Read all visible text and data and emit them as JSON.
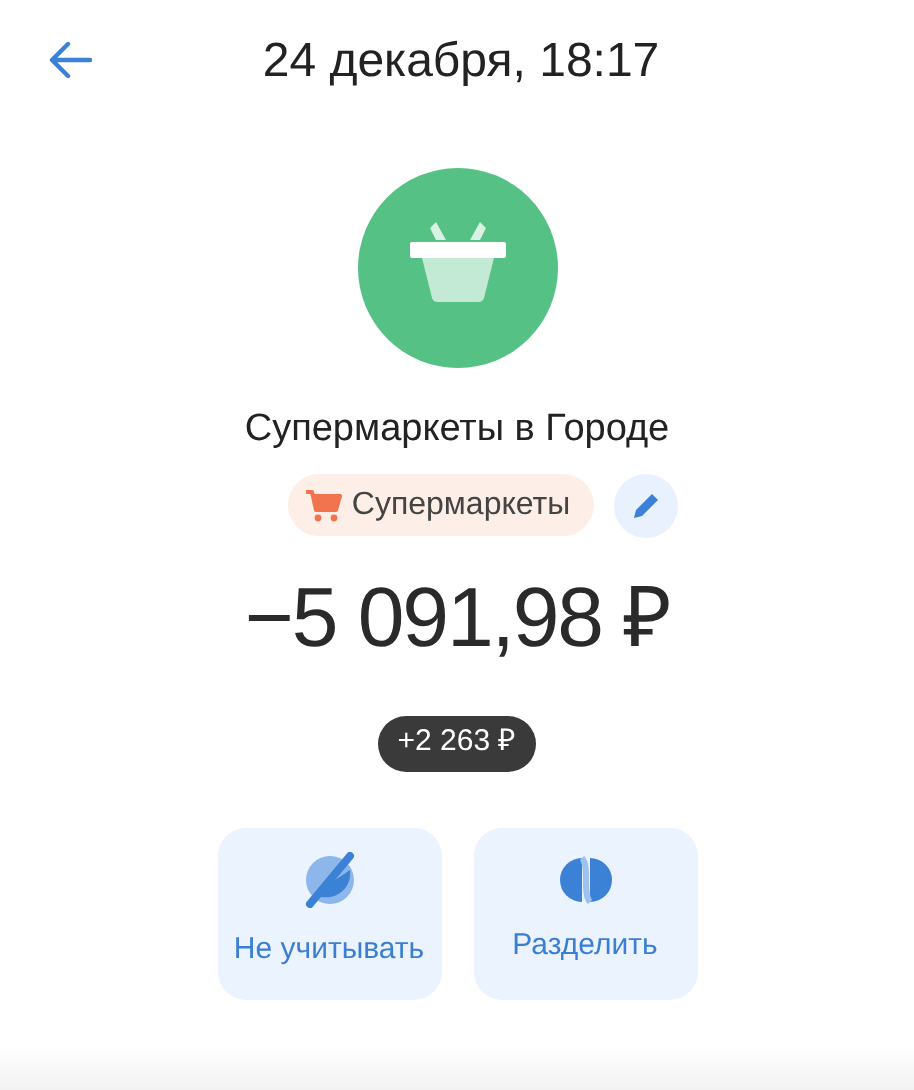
{
  "header": {
    "title": "24 декабря, 18:17"
  },
  "merchant": {
    "name": "Супермаркеты в Городе"
  },
  "category": {
    "label": "Супермаркеты"
  },
  "amount": "−5 091,98 ₽",
  "cashback": "+2 263 ₽",
  "actions": [
    {
      "kind": "ignore",
      "label": "Не учитывать"
    },
    {
      "kind": "split",
      "label": "Разделить"
    }
  ]
}
